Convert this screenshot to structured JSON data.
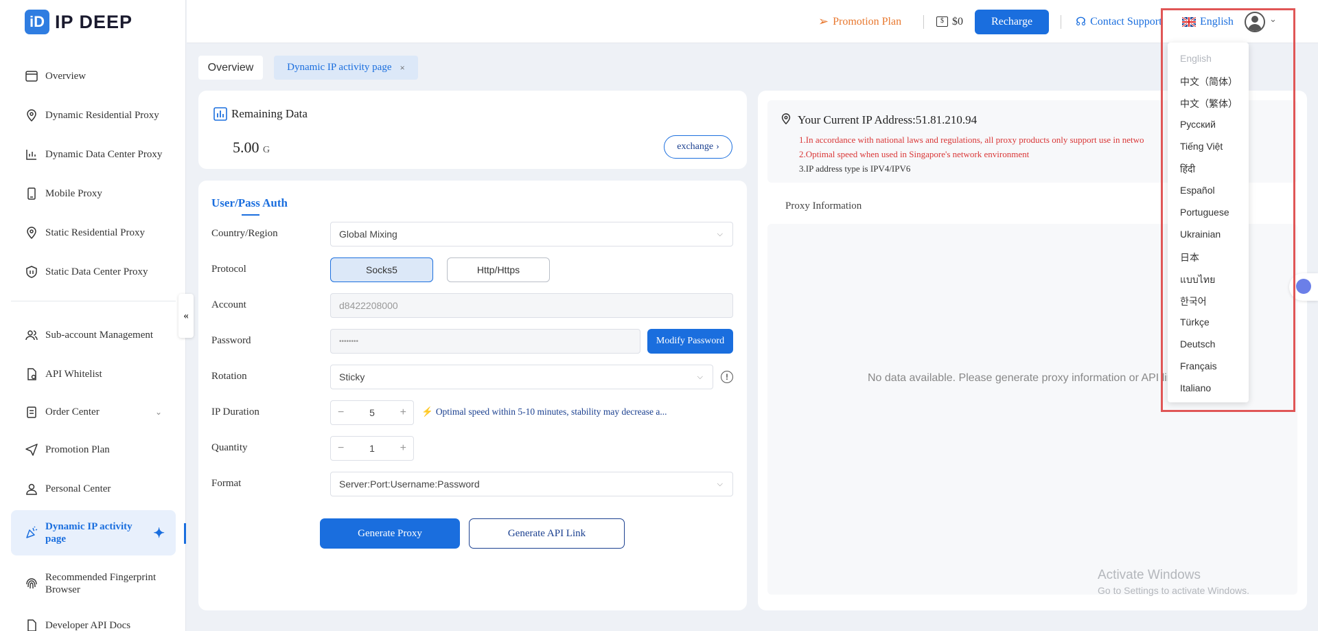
{
  "brand": {
    "logo_letter": "iD",
    "name": "IP DEEP"
  },
  "sidebar": {
    "items": [
      {
        "label": "Overview",
        "icon": "browser-icon"
      },
      {
        "label": "Dynamic Residential Proxy",
        "icon": "location-pin-icon"
      },
      {
        "label": "Dynamic Data Center Proxy",
        "icon": "chart-icon"
      },
      {
        "label": "Mobile Proxy",
        "icon": "mobile-icon"
      },
      {
        "label": "Static Residential Proxy",
        "icon": "location-pin-icon"
      },
      {
        "label": "Static Data Center Proxy",
        "icon": "shield-icon"
      },
      {
        "label": "Sub-account Management",
        "icon": "users-icon"
      },
      {
        "label": "API Whitelist",
        "icon": "document-icon"
      },
      {
        "label": "Order Center",
        "icon": "clipboard-icon"
      },
      {
        "label": "Promotion Plan",
        "icon": "paper-plane-icon"
      },
      {
        "label": "Personal Center",
        "icon": "user-icon"
      },
      {
        "label": "Dynamic IP activity page",
        "icon": "party-icon"
      },
      {
        "label": "Recommended Fingerprint Browser",
        "icon": "fingerprint-icon"
      },
      {
        "label": "Developer API Docs",
        "icon": "document-icon"
      }
    ],
    "collapse_symbol": "«"
  },
  "header": {
    "promotion": "Promotion Plan",
    "balance": "$0",
    "recharge": "Recharge",
    "support": "Contact Support",
    "language": "English"
  },
  "tabs": {
    "overview": "Overview",
    "activity": "Dynamic IP activity page",
    "close": "×"
  },
  "remaining": {
    "title": "Remaining Data",
    "value": "5.00",
    "unit": "G",
    "exchange": "exchange"
  },
  "auth": {
    "title": "User/Pass Auth",
    "country_label": "Country/Region",
    "country_value": "Global Mixing",
    "protocol_label": "Protocol",
    "protocol_socks": "Socks5",
    "protocol_http": "Http/Https",
    "account_label": "Account",
    "account_value": "d8422208000",
    "password_label": "Password",
    "password_value": "••••••••",
    "modify": "Modify Password",
    "rotation_label": "Rotation",
    "rotation_value": "Sticky",
    "duration_label": "IP Duration",
    "duration_value": "5",
    "duration_tip": "Optimal speed within 5-10 minutes, stability may decrease a...",
    "quantity_label": "Quantity",
    "quantity_value": "1",
    "format_label": "Format",
    "format_value": "Server:Port:Username:Password",
    "generate": "Generate Proxy",
    "api_link": "Generate API Link"
  },
  "ip_panel": {
    "title": "Your Current IP Address:51.81.210.94",
    "notes": [
      "1.In accordance with national laws and regulations, all proxy products only support use in netwo",
      "2.Optimal speed when used in Singapore's network environment",
      "3.IP address type is IPV4/IPV6"
    ],
    "proxy_info": "Proxy Information",
    "empty": "No data available. Please generate proxy information or API lir"
  },
  "language_menu": [
    "English",
    "中文（简体）",
    "中文（繁体）",
    "Русский",
    "Tiếng Việt",
    "हिंदी",
    "Español",
    "Portuguese",
    "Ukrainian",
    "日本",
    "แบบไทย",
    "한국어",
    "Türkçe",
    "Deutsch",
    "Français",
    "Italiano"
  ],
  "watermark": {
    "title": "Activate Windows",
    "subtitle": "Go to Settings to activate Windows."
  },
  "colors": {
    "accent": "#1a6ede",
    "promo": "#e8782f",
    "warning": "#d93636",
    "highlight": "#e05656"
  }
}
